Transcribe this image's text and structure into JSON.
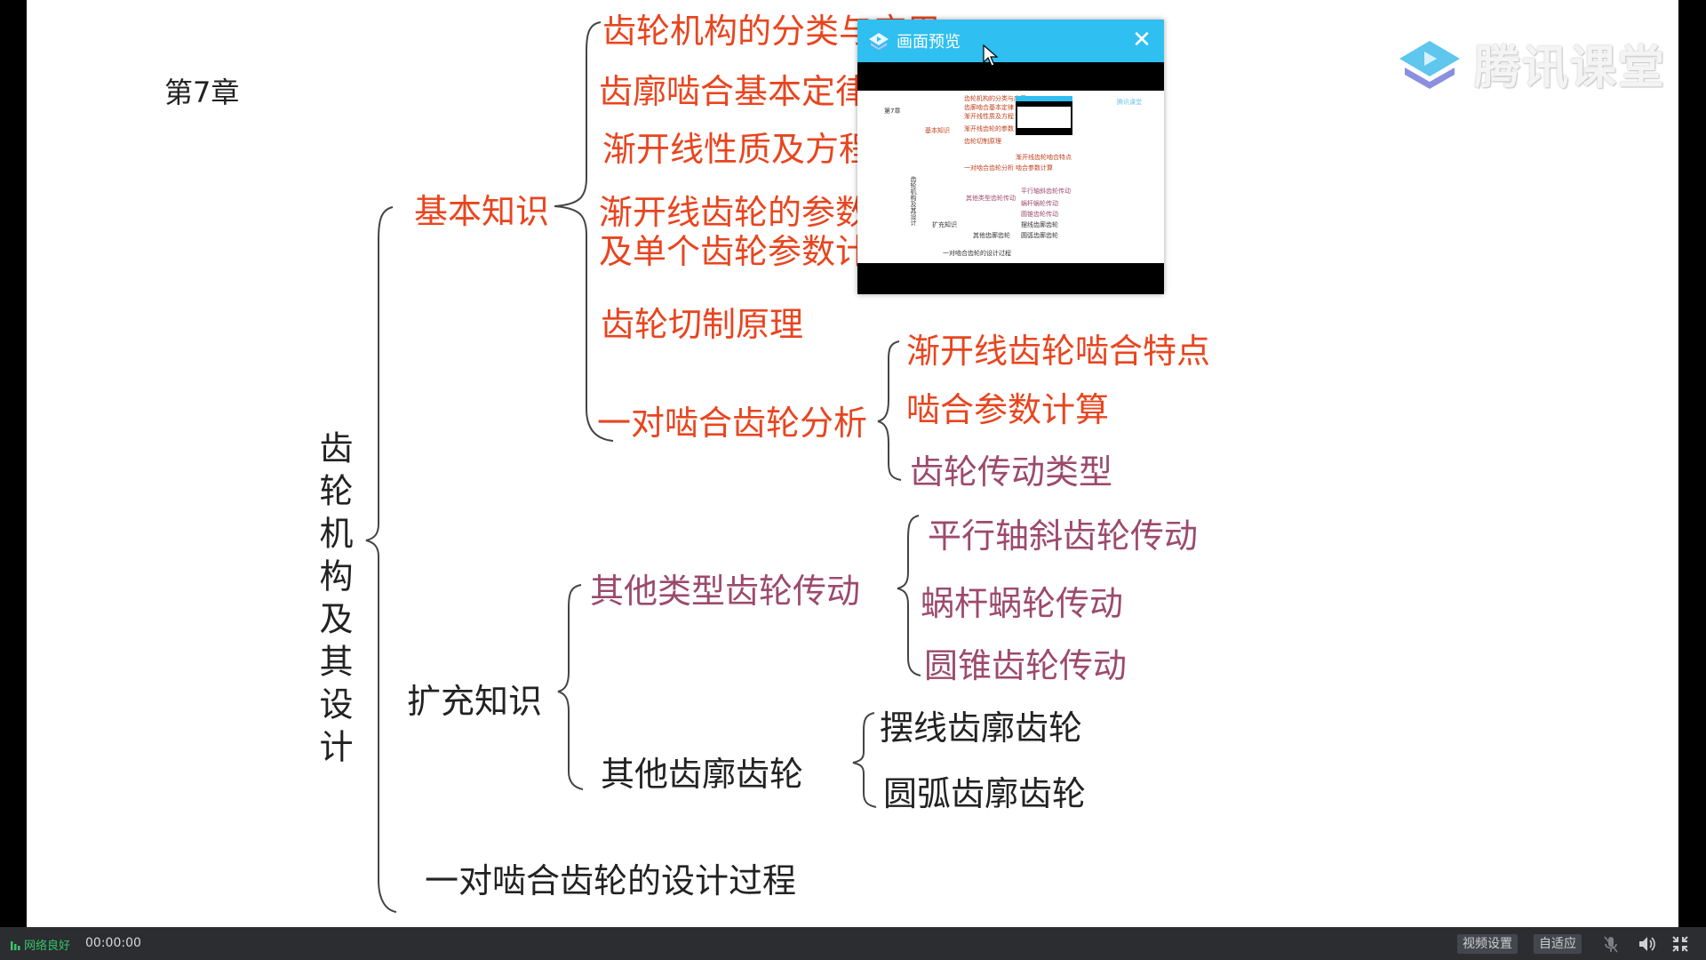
{
  "slide": {
    "chapter": "第7章",
    "root": "齿轮机构及其设计",
    "branch_basic": {
      "label": "基本知识",
      "items": [
        "齿轮机构的分类与应用",
        "齿廓啮合基本定律",
        "渐开线性质及方程",
        "渐开线齿轮的参数",
        "及单个齿轮参数计算",
        "齿轮切制原理"
      ],
      "pair_analysis": {
        "label": "一对啮合齿轮分析",
        "items": [
          "渐开线齿轮啮合特点",
          "啮合参数计算",
          "齿轮传动类型"
        ]
      }
    },
    "branch_extended": {
      "label": "扩充知识",
      "other_drives": {
        "label": "其他类型齿轮传动",
        "items": [
          "平行轴斜齿轮传动",
          "蜗杆蜗轮传动",
          "圆锥齿轮传动"
        ]
      },
      "other_profiles": {
        "label": "其他齿廓齿轮",
        "items": [
          "摆线齿廓齿轮",
          "圆弧齿廓齿轮"
        ]
      }
    },
    "design_process": "一对啮合齿轮的设计过程"
  },
  "logo": {
    "text": "腾讯课堂",
    "icon": "tencent-classroom-logo-icon"
  },
  "preview_popup": {
    "title": "画面预览",
    "icon": "preview-app-icon",
    "close_icon": "close-icon"
  },
  "bottom_bar": {
    "network_status": "网络良好",
    "network_icon": "signal-bars-icon",
    "elapsed_time": "00:00:00",
    "video_settings_label": "视频设置",
    "adaptive_label": "自适应",
    "mic_icon": "mic-muted-icon",
    "speaker_icon": "speaker-icon",
    "exit_fullscreen_icon": "exit-fullscreen-icon"
  },
  "colors": {
    "primary_text_red": "#e8451f",
    "secondary_text_mauve": "#9c4a6c",
    "popup_titlebar": "#2fbff0",
    "network_ok": "#35c46a",
    "bottom_bar_bg": "#2b2d31"
  }
}
